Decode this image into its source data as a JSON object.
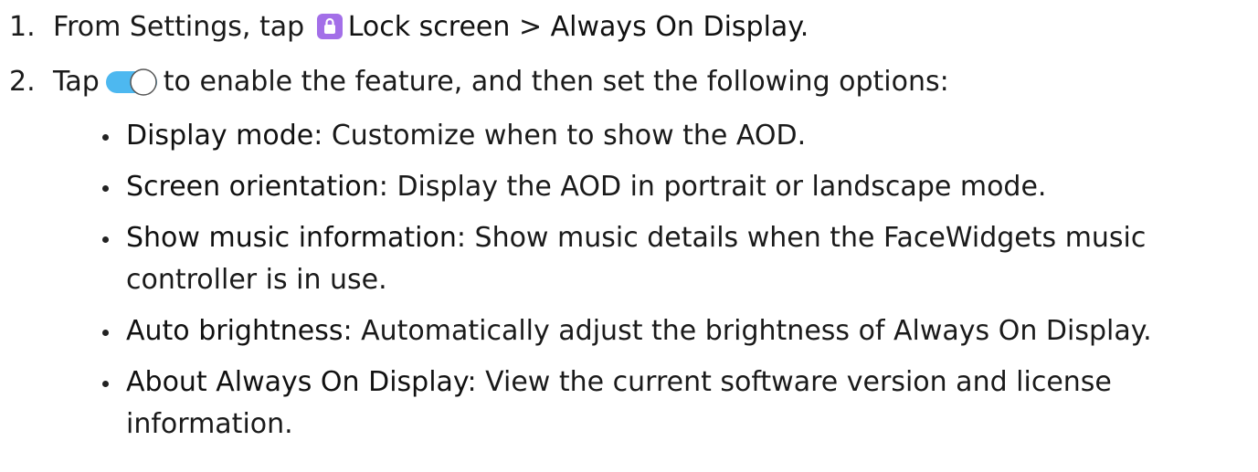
{
  "steps": [
    {
      "number": "1.",
      "prefix": "From Settings, tap",
      "icon": "lock-icon",
      "term1": "Lock screen",
      "separator": ">",
      "term2": "Always On Display",
      "suffix": "."
    },
    {
      "number": "2.",
      "prefix": "Tap",
      "icon": "toggle-icon",
      "rest": "to enable the feature, and then set the following options:"
    }
  ],
  "options": [
    {
      "term": "Display mode",
      "sep": ":",
      "text": " Customize when to show the AOD."
    },
    {
      "term": "Screen orientation",
      "sep": ":",
      "text": " Display the AOD in portrait or landscape mode."
    },
    {
      "term": "Show music information",
      "sep": ":",
      "text": " Show music details when the FaceWidgets music controller is in use."
    },
    {
      "term": "Auto brightness",
      "sep": ":",
      "text": " Automatically adjust the brightness of Always On Display."
    },
    {
      "term": "About Always On Display",
      "sep": ":",
      "text": " View the current software version and license information."
    }
  ],
  "colors": {
    "lock_icon_bg": "#a36fe8",
    "toggle_on": "#4db8f0"
  }
}
